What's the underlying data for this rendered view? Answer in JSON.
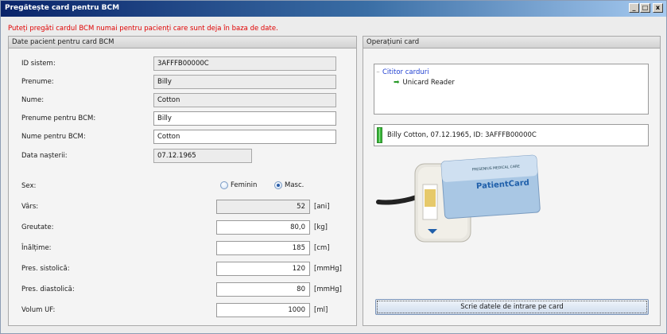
{
  "window": {
    "title": "Pregătește card pentru BCM",
    "buttons": [
      "_",
      "□",
      "x"
    ]
  },
  "info_text": "Puteți pregăti cardul BCM numai pentru pacienți care sunt deja în baza de date.",
  "left": {
    "header": "Date pacient pentru card BCM",
    "id_label": "ID sistem:",
    "id_value": "3AFFFB00000C",
    "prenume_label": "Prenume:",
    "prenume_value": "Billy",
    "nume_label": "Nume:",
    "nume_value": "Cotton",
    "prenume_bcm_label": "Prenume pentru BCM:",
    "prenume_bcm_value": "Billy",
    "nume_bcm_label": "Nume pentru BCM:",
    "nume_bcm_value": "Cotton",
    "dob_label": "Data nașterii:",
    "dob_value": "07.12.1965",
    "sex_label": "Sex:",
    "sex_female": "Feminin",
    "sex_male": "Masc.",
    "sex_selected": "Masc.",
    "age_label": "Vârs:",
    "age_value": "52",
    "age_unit": "[ani]",
    "weight_label": "Greutate:",
    "weight_value": "80,0",
    "weight_unit": "[kg]",
    "height_label": "Înălțime:",
    "height_value": "185",
    "height_unit": "[cm]",
    "sys_label": "Pres. sistolică:",
    "sys_value": "120",
    "sys_unit": "[mmHg]",
    "dia_label": "Pres. diastolică:",
    "dia_value": "80",
    "dia_unit": "[mmHg]",
    "uf_label": "Volum UF:",
    "uf_value": "1000",
    "uf_unit": "[ml]"
  },
  "right": {
    "header": "Operațiuni card",
    "tree_root": "Cititor carduri",
    "tree_child": "Unicard Reader",
    "status_text": "Billy Cotton, 07.12.1965, ID: 3AFFFB00000C",
    "card_logo": "PatientCard",
    "card_brand": "FRESENIUS MEDICAL CARE",
    "write_button": "Scrie datele de intrare pe card"
  },
  "colors": {
    "info": "#e00000",
    "tree_root": "#1f3fd1",
    "status_green": "#3bb43b"
  }
}
